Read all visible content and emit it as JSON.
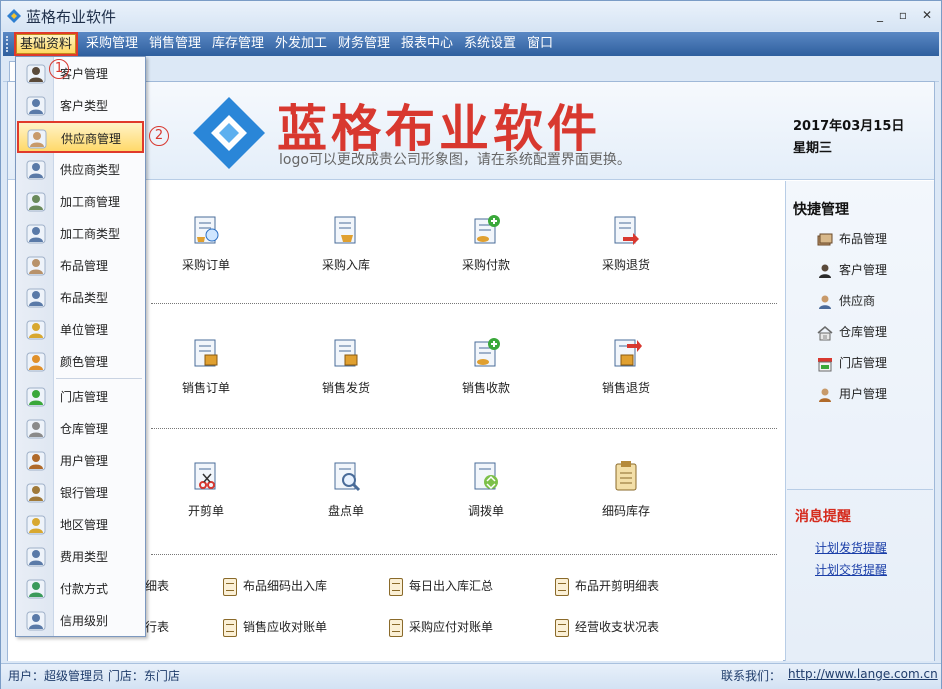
{
  "window": {
    "title": "蓝格布业软件",
    "minimize": "_",
    "maximize": "▫",
    "close": "✕"
  },
  "menubar": [
    "基础资料",
    "采购管理",
    "销售管理",
    "库存管理",
    "外发加工",
    "财务管理",
    "报表中心",
    "系统设置",
    "窗口"
  ],
  "banner": {
    "brand": "蓝格布业软件",
    "subtitle": "logo可以更改成贵公司形象图，请在系统配置界面更换。",
    "date": "2017年03月15日",
    "weekday": "星期三"
  },
  "dropdown": {
    "items": [
      {
        "label": "客户管理",
        "icon": "customer-icon"
      },
      {
        "label": "客户类型",
        "icon": "customer-type-icon"
      },
      {
        "label": "供应商管理",
        "icon": "supplier-icon"
      },
      {
        "label": "供应商类型",
        "icon": "supplier-type-icon"
      },
      {
        "label": "加工商管理",
        "icon": "processor-icon"
      },
      {
        "label": "加工商类型",
        "icon": "processor-type-icon"
      },
      {
        "label": "布品管理",
        "icon": "fabric-icon"
      },
      {
        "label": "布品类型",
        "icon": "fabric-type-icon"
      },
      {
        "label": "单位管理",
        "icon": "unit-icon"
      },
      {
        "label": "颜色管理",
        "icon": "palette-icon"
      },
      {
        "label": "门店管理",
        "icon": "store-icon"
      },
      {
        "label": "仓库管理",
        "icon": "warehouse-icon"
      },
      {
        "label": "用户管理",
        "icon": "user-icon"
      },
      {
        "label": "银行管理",
        "icon": "bank-icon"
      },
      {
        "label": "地区管理",
        "icon": "map-pin-icon"
      },
      {
        "label": "费用类型",
        "icon": "expense-icon"
      },
      {
        "label": "付款方式",
        "icon": "payment-icon"
      },
      {
        "label": "信用级别",
        "icon": "credit-icon"
      }
    ]
  },
  "steps": {
    "one": "1",
    "two": "2"
  },
  "purchase": [
    "采购订单",
    "采购入库",
    "采购付款",
    "采购退货"
  ],
  "sales": [
    "销售订单",
    "销售发货",
    "销售收款",
    "销售退货"
  ],
  "inventory": [
    "开剪单",
    "盘点单",
    "调拨单",
    "细码库存"
  ],
  "reports": {
    "row1": [
      "细表",
      "布品细码出入库",
      "每日出入库汇总",
      "布品开剪明细表"
    ],
    "row2": [
      "行表",
      "销售应收对账单",
      "采购应付对账单",
      "经营收支状况表"
    ]
  },
  "quick": {
    "title": "快捷管理",
    "items": [
      "布品管理",
      "客户管理",
      "供应商",
      "仓库管理",
      "门店管理",
      "用户管理"
    ]
  },
  "messages": {
    "title": "消息提醒",
    "links": [
      "计划发货提醒",
      "计划交货提醒"
    ]
  },
  "status": {
    "user": "用户：超级管理员  门店：东门店",
    "contact": "联系我们：",
    "url": "http://www.lange.com.cn"
  },
  "colors": {
    "brand_red": "#d8382f",
    "menu_blue": "#2f5f9e",
    "highlight": "#ffd96a"
  }
}
